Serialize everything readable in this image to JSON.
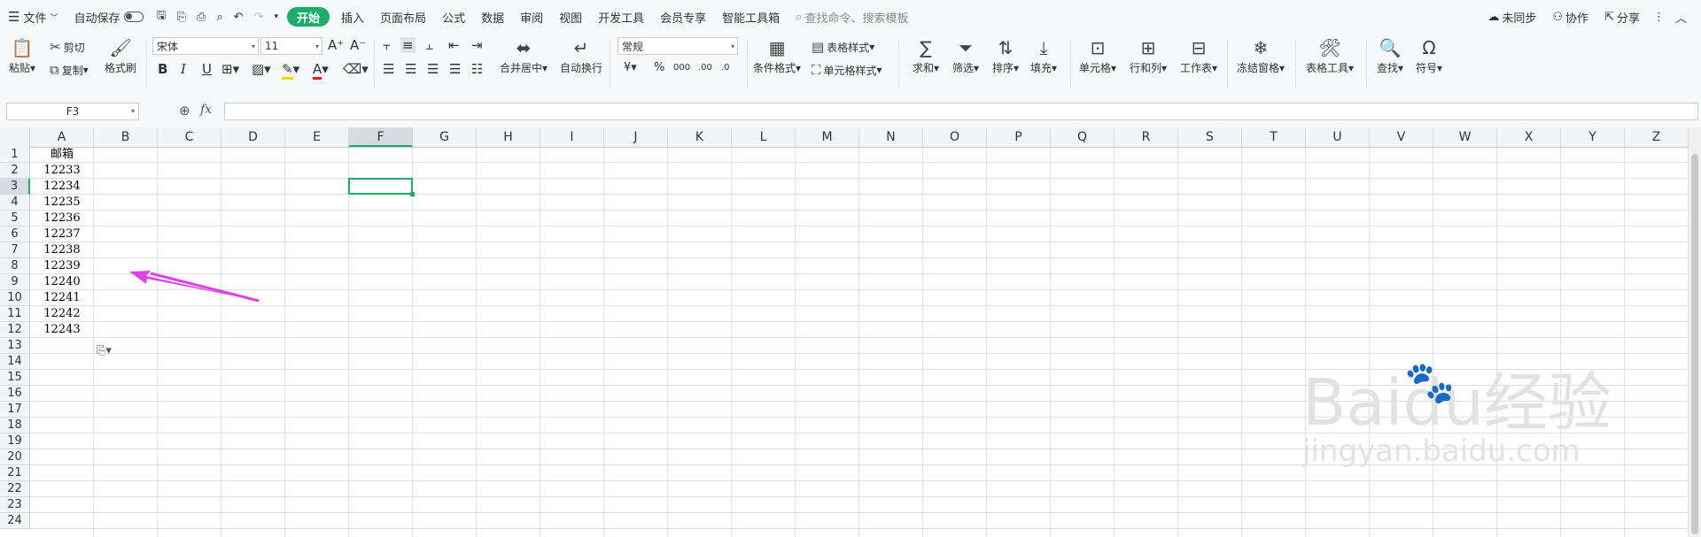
{
  "menu": {
    "file": "文件",
    "autosave": "自动保存",
    "tabs": [
      "开始",
      "插入",
      "页面布局",
      "公式",
      "数据",
      "审阅",
      "视图",
      "开发工具",
      "会员专享",
      "智能工具箱"
    ],
    "active_tab": "开始",
    "search_placeholder": "查找命令、搜索模板",
    "sync": "未同步",
    "collab": "协作",
    "share": "分享"
  },
  "ribbon": {
    "paste": "粘贴",
    "cut": "剪切",
    "copy": "复制",
    "format_painter": "格式刷",
    "font_name": "宋体",
    "font_size": "11",
    "merge_center": "合并居中",
    "wrap_text": "自动换行",
    "number_format": "常规",
    "currency": "¥",
    "percent": "%",
    "thousands": "000",
    "inc_decimal": ".00",
    "dec_decimal": ".0",
    "cond_format": "条件格式",
    "table_style": "表格样式",
    "cell_style": "单元格样式",
    "sum": "求和",
    "filter": "筛选",
    "sort": "排序",
    "fill": "填充",
    "cell": "单元格",
    "row_col": "行和列",
    "worksheet": "工作表",
    "freeze": "冻结窗格",
    "table_tools": "表格工具",
    "find": "查找",
    "symbol": "符号"
  },
  "formula_bar": {
    "name_box": "F3",
    "fx": "fx",
    "value": ""
  },
  "grid": {
    "columns": [
      "A",
      "B",
      "C",
      "D",
      "E",
      "F",
      "G",
      "H",
      "I",
      "J",
      "K",
      "L",
      "M",
      "N",
      "O",
      "P",
      "Q",
      "R",
      "S",
      "T",
      "U",
      "V",
      "W",
      "X",
      "Y",
      "Z"
    ],
    "rows": [
      "1",
      "2",
      "3",
      "4",
      "5",
      "6",
      "7",
      "8",
      "9",
      "10",
      "11",
      "12",
      "13",
      "14",
      "15",
      "16",
      "17",
      "18",
      "19",
      "20",
      "21",
      "22",
      "23",
      "24"
    ],
    "active_column": "F",
    "active_row": "3",
    "column_a": [
      "邮箱",
      "12233",
      "12234",
      "12235",
      "12236",
      "12237",
      "12238",
      "12239",
      "12240",
      "12241",
      "12242",
      "12243"
    ]
  },
  "colors": {
    "accent": "#1aad6b",
    "arrow": "#e040e8"
  },
  "watermark": {
    "brand": "Baidu经验",
    "url": "jingyan.baidu.com"
  }
}
